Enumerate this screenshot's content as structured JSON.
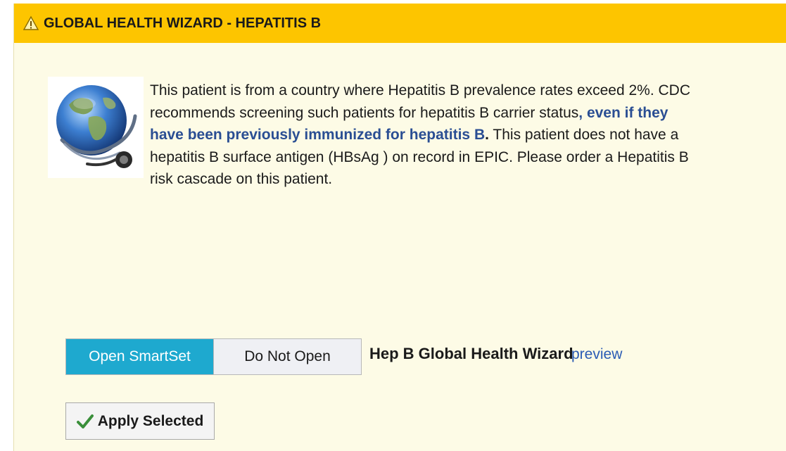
{
  "dialog": {
    "title": "GLOBAL HEALTH WIZARD - HEPATITIS B",
    "title_icon": "warning-triangle-icon",
    "image": "globe-stethoscope-image"
  },
  "message": {
    "part1": "This patient is from a country where Hepatitis B prevalence rates exceed 2%. CDC recommends screening such patients for hepatitis B carrier status",
    "part2": ", even if they have been previously immunized for hepatitis B",
    "part3": ".",
    "part4": " This patient does not have a hepatitis B surface antigen (HBsAg ) on record in EPIC. Please order a Hepatitis B risk cascade on this patient."
  },
  "smartset": {
    "options": [
      "Open SmartSet",
      "Do Not Open"
    ],
    "selected": "Open SmartSet",
    "name": "Hep B Global Health Wizard",
    "preview_link": "preview"
  },
  "actions": {
    "apply_label": "Apply Selected",
    "apply_icon": "checkmark-icon"
  },
  "colors": {
    "titlebar": "#fdc500",
    "background": "#fdfbe6",
    "selected_option": "#1ea9cf",
    "emphasis_text": "#2a4e93",
    "link": "#2a5bb4",
    "check": "#3a8f3a"
  }
}
